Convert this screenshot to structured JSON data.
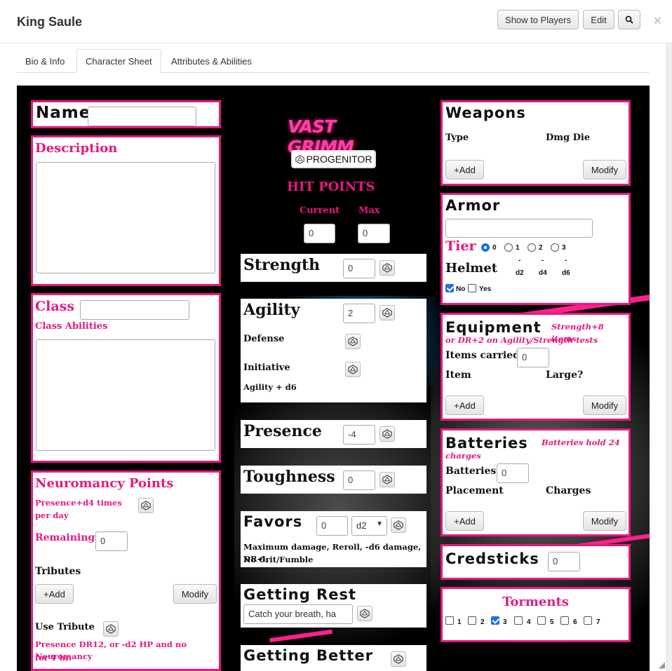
{
  "header": {
    "title": "King Saule",
    "show_players": "Show to Players",
    "edit": "Edit"
  },
  "tabs": [
    "Bio & Info",
    "Character Sheet",
    "Attributes & Abilities"
  ],
  "logo": {
    "text": "VAST GRIMM",
    "badge": "PROGENITOR"
  },
  "name": {
    "label": "Name",
    "value": ""
  },
  "description": {
    "label": "Description"
  },
  "class": {
    "label": "Class",
    "abilities_label": "Class Abilities",
    "value": ""
  },
  "neuromancy": {
    "title": "Neuromancy Points",
    "note1": "Presence+d4 times",
    "note2": "per day",
    "remaining_label": "Remaining",
    "remaining_value": "0",
    "tributes_label": "Tributes",
    "add": "+Add",
    "modify": "Modify",
    "use_tribute_label": "Use Tribute",
    "use_note1": "Presence DR12, or -d2 HP and no Neuromancy",
    "use_note2": "for 1 hr."
  },
  "hit_points": {
    "title": "HIT POINTS",
    "current_label": "Current",
    "max_label": "Max",
    "current": "0",
    "max": "0"
  },
  "strength": {
    "label": "Strength",
    "value": "0"
  },
  "agility": {
    "label": "Agility",
    "value": "2",
    "defense": "Defense",
    "initiative": "Initiative",
    "init_note": "Agility + d6"
  },
  "presence": {
    "label": "Presence",
    "value": "-4"
  },
  "toughness": {
    "label": "Toughness",
    "value": "0"
  },
  "favors": {
    "label": "Favors",
    "value": "0",
    "die": "d2",
    "note1": "Maximum damage, Reroll, -d6 damage, DR-4,",
    "note2": "No Crit/Fumble"
  },
  "rest": {
    "label": "Getting Rest",
    "select": "Catch your breath, ha"
  },
  "better": {
    "label": "Getting Better"
  },
  "weapons": {
    "title": "Weapons",
    "col1": "Type",
    "col2": "Dmg Die",
    "add": "+Add",
    "modify": "Modify"
  },
  "armor": {
    "title": "Armor",
    "value": "",
    "tier_label": "Tier",
    "tiers": [
      "0",
      "1",
      "2",
      "3"
    ],
    "tier_selected": "0",
    "helmet_label": "Helmet",
    "helmet_dashes": [
      "-",
      "-",
      "-"
    ],
    "helmet_dice": [
      "d2",
      "d4",
      "d6"
    ],
    "no": "No",
    "yes": "Yes"
  },
  "equipment": {
    "title": "Equipment",
    "note1": "Strength+8 items",
    "note2": "or DR+2 on Agility/Strength tests",
    "carried_label": "Items carried",
    "carried_value": "0",
    "col1": "Item",
    "col2": "Large?",
    "add": "+Add",
    "modify": "Modify"
  },
  "batteries": {
    "title": "Batteries",
    "note1": "Batteries hold 24",
    "note2": "charges",
    "count_label": "Batteries",
    "count_value": "0",
    "col1": "Placement",
    "col2": "Charges",
    "add": "+Add",
    "modify": "Modify"
  },
  "credsticks": {
    "title": "Credsticks",
    "value": "0"
  },
  "torments": {
    "title": "Torments",
    "items": [
      "1",
      "2",
      "3",
      "4",
      "5",
      "6",
      "7"
    ],
    "checked": [
      "3"
    ]
  },
  "colors": {
    "accent": "#e6197f",
    "check": "#1a73e8"
  }
}
